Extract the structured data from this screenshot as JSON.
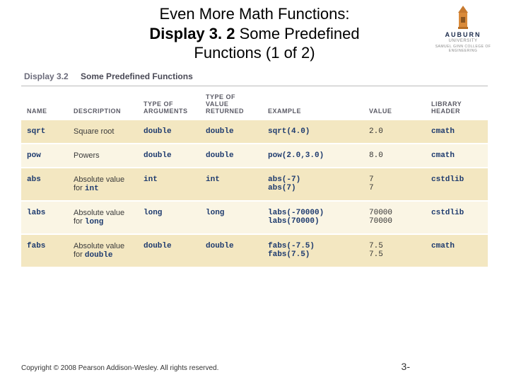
{
  "title": {
    "line1": "Even More Math Functions:",
    "line2_bold": "Display 3. 2",
    "line2_rest": "  Some Predefined",
    "line3": "Functions (1 of 2)"
  },
  "logo": {
    "name": "AUBURN",
    "sub": "UNIVERSITY",
    "eng": "SAMUEL GINN COLLEGE OF ENGINEERING"
  },
  "caption": {
    "label": "Display 3.2",
    "title": "Some Predefined Functions"
  },
  "headers": [
    "NAME",
    "DESCRIPTION",
    "TYPE OF ARGUMENTS",
    "TYPE OF VALUE RETURNED",
    "EXAMPLE",
    "VALUE",
    "LIBRARY HEADER"
  ],
  "rows": [
    {
      "name": "sqrt",
      "desc": "Square root",
      "arg": "double",
      "ret": "double",
      "ex": "sqrt(4.0)",
      "val": "2.0",
      "lib": "cmath"
    },
    {
      "name": "pow",
      "desc": "Powers",
      "arg": "double",
      "ret": "double",
      "ex": "pow(2.0,3.0)",
      "val": "8.0",
      "lib": "cmath"
    },
    {
      "name": "abs",
      "desc": "Absolute value for",
      "desc_kw": "int",
      "arg": "int",
      "ret": "int",
      "ex": "abs(-7)\nabs(7)",
      "val": "7\n7",
      "lib": "cstdlib"
    },
    {
      "name": "labs",
      "desc": "Absolute value for",
      "desc_kw": "long",
      "arg": "long",
      "ret": "long",
      "ex": "labs(-70000)\nlabs(70000)",
      "val": "70000\n70000",
      "lib": "cstdlib"
    },
    {
      "name": "fabs",
      "desc": "Absolute value for",
      "desc_kw": "double",
      "arg": "double",
      "ret": "double",
      "ex": "fabs(-7.5)\nfabs(7.5)",
      "val": "7.5\n7.5",
      "lib": "cmath"
    }
  ],
  "footer": {
    "copyright": "Copyright © 2008 Pearson Addison-Wesley. All rights reserved.",
    "page": "3-"
  }
}
